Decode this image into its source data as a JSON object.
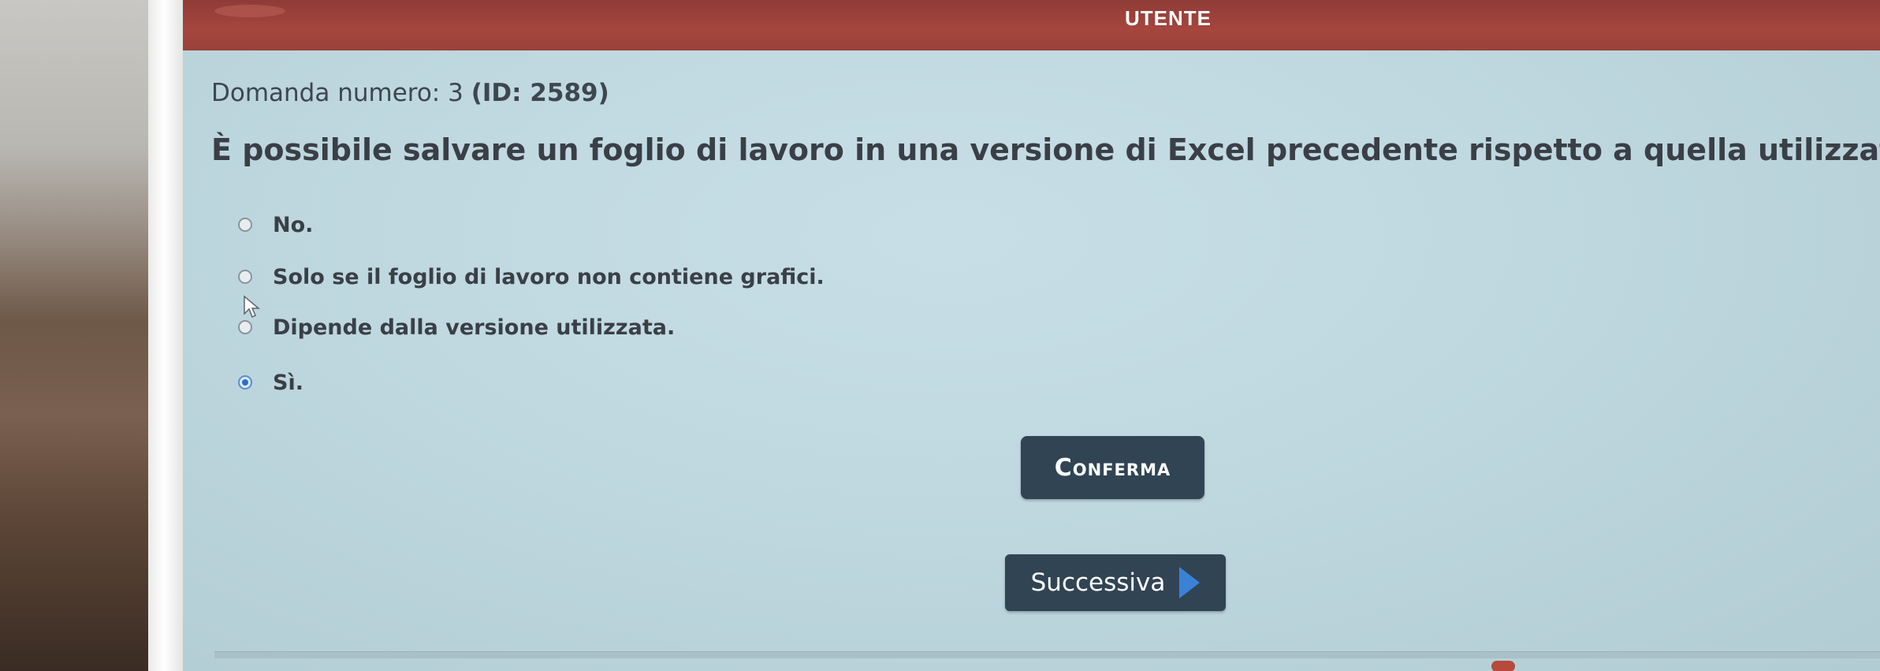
{
  "header": {
    "title": "UTENTE"
  },
  "question": {
    "number_label": "Domanda numero: 3",
    "id_label": "(ID: 2589)",
    "text": "È possibile salvare un foglio di lavoro in una versione di Excel precedente rispetto a quella utilizzata?"
  },
  "options": [
    {
      "label": "No.",
      "selected": false
    },
    {
      "label": "Solo se il foglio di lavoro non contiene grafici.",
      "selected": false
    },
    {
      "label": "Dipende dalla versione utilizzata.",
      "selected": false
    },
    {
      "label": "Sì.",
      "selected": true
    }
  ],
  "buttons": {
    "confirm_label": "Conferma",
    "next_label": "Successiva"
  },
  "colors": {
    "header_bar": "#9a413a",
    "background": "#c2dae2",
    "button": "#314454",
    "next_arrow": "#3b82d6",
    "selected_radio": "#2f6fc3"
  },
  "icons": {
    "next": "play-icon",
    "pointer": "mouse-cursor-icon"
  }
}
